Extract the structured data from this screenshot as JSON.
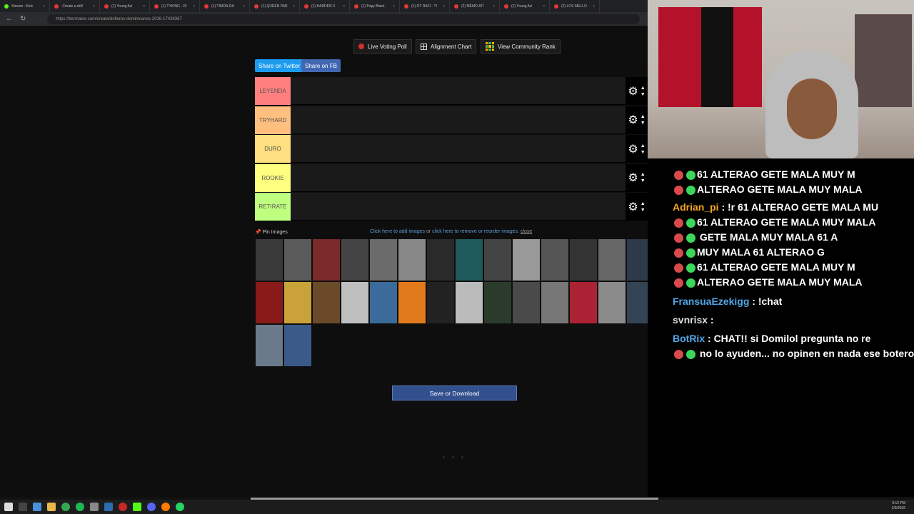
{
  "browser": {
    "tabs": [
      "Stream - Kick",
      ".Create a drill",
      "(1) Young Avi",
      "(1) TYKING - Ri",
      "(1) TIMON DA",
      "(1) QUEEN PAR",
      "(1) HARDEN X",
      "(1) Papy Black",
      "(1) OT RAFI - TI",
      "(2) MEMO ATI",
      "(1) Young Avi",
      "(2) LOS MELLO"
    ],
    "url": "https://tiermaker.com/create/drilleros-dominicanos-2026-17438367"
  },
  "toolbar": {
    "live_poll": "Live Voting Poll",
    "alignment": "Alignment Chart",
    "community": "View Community Rank"
  },
  "share": {
    "twitter": "Share on Twitter",
    "fb": "Share on FB"
  },
  "tiers": [
    {
      "label": "LEYENDA",
      "color": "#ff7f7f"
    },
    {
      "label": "TRYHARD",
      "color": "#ffbf7f"
    },
    {
      "label": "DURO",
      "color": "#ffdf7f"
    },
    {
      "label": "ROOKIE",
      "color": "#ffff7f"
    },
    {
      "label": "RETIRATE",
      "color": "#bfff7f"
    }
  ],
  "images": {
    "pin_label": "Pin Images",
    "add_text": "Click here to add images",
    "or_text": " or ",
    "remove_text": "click here to remove or reorder images.",
    "close_text": "close",
    "thumb_colors": [
      "#3a3a3a",
      "#5a5a5a",
      "#7a2a2a",
      "#444",
      "#6b6b6b",
      "#888",
      "#2a2a2a",
      "#1f5a5a",
      "#444",
      "#999",
      "#555",
      "#333",
      "#666",
      "#2d3a4a",
      "#8a1a1a",
      "#c9a23a",
      "#6b4a2a",
      "#bfbfbf",
      "#3a6b9a",
      "#e07a1a",
      "#222",
      "#bbb",
      "#2b3b2b",
      "#4a4a4a",
      "#777",
      "#aa2233",
      "#8b8b8b",
      "#345",
      "#6a7a8a",
      "#3a5a8a"
    ]
  },
  "save_label": "Save or Download",
  "chat": {
    "lines": [
      {
        "type": "spam",
        "text": "61 ALTERAO  GETE MALA MUY M"
      },
      {
        "type": "spam",
        "text": "ALTERAO  GETE MALA MUY MALA"
      },
      {
        "type": "user",
        "user": "Adrian_pi",
        "msg": " : !r 61 ALTERAO  GETE MALA MU"
      },
      {
        "type": "spam",
        "text": "61 ALTERAO  GETE MALA MUY MALA"
      },
      {
        "type": "spam",
        "text": " GETE MALA MUY MALA  61 A"
      },
      {
        "type": "spam",
        "text": "MUY MALA  61 ALTERAO  G"
      },
      {
        "type": "spam",
        "text": "61 ALTERAO  GETE MALA MUY M"
      },
      {
        "type": "spam",
        "text": "ALTERAO  GETE MALA MUY MALA"
      },
      {
        "type": "user",
        "user": "FransuaEzekigg",
        "msg": " : !chat"
      },
      {
        "type": "user",
        "user": "svnrisx",
        "msg": " :"
      },
      {
        "type": "user",
        "user": "BotRix",
        "msg": " :  CHAT!! si Domilol pregunta  no re"
      },
      {
        "type": "spam",
        "text": " no lo ayuden... no opinen en nada  ese botero n"
      }
    ]
  },
  "clock": {
    "time": "9:12 PM",
    "date": "1/9/2026"
  }
}
